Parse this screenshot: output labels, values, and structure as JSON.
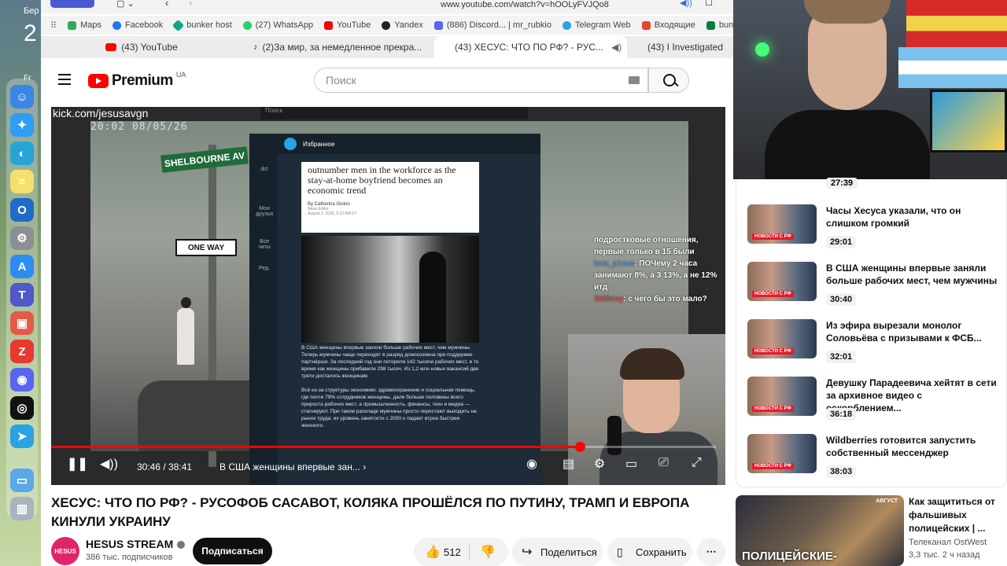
{
  "desktop": {
    "clock_a": "Бер",
    "clock_b": "2",
    "clock_c": "Fr"
  },
  "browser": {
    "url": "www.youtube.com/watch?v=hOOLyFVJQo8",
    "bookmarks": [
      "Maps",
      "Facebook",
      "bunker host",
      "(27) WhatsApp",
      "YouTube",
      "Yandex",
      "(886) Discord... | mr_rubkio",
      "Telegram Web",
      "Входящие",
      "bun"
    ],
    "tabs": [
      "(43) YouTube",
      "(2)За мир, за немедленное прекра...",
      "(43) ХЕСУС: ЧТО ПО РФ? - РУС...",
      "(43) I Investigated"
    ]
  },
  "header": {
    "logo": "Premium",
    "region": "UA",
    "search_placeholder": "Поиск"
  },
  "player": {
    "watermark": "kick.com/jesusavgn",
    "timestamp": "20:02  08/05/26",
    "street_sign": "SHELBOURNE AV",
    "oneway_sign": "ONE WAY",
    "tg_search": "Поиск",
    "tg_header": "Избранное",
    "tg_side": [
      "dct",
      "Мои друзья",
      "Все чаты",
      "Ред."
    ],
    "article_headline": "outnumber men in the workforce as the stay-at-home boyfriend becomes an economic trend",
    "article_by": "By Catherina Gioino",
    "article_role": "News Editor",
    "article_date": "August 2, 2026, 9:22 AM ET",
    "tg_message": "В США женщины впервые заняли больше рабочих мест, чем мужчины. Теперь мужчины чаще переходят в разряд домохозяина при поддержке партнёрши. За последний год они потеряли 142 тысячи рабочих мест, в то время как женщины прибавили 298 тысяч. Из 1,2 млн новых вакансий две трети досталось женщинам.\n\nВсё из-за структуры экономики: здравоохранение и социальная помощь, где почти 79% сотрудников женщины, дали больше половины всего прироста рабочих мест, а промышленность, финансы, техн и медиа — стагнируют. При таком раскладе мужчины просто перестают выходить на рынок труда: их уровень занятости с 2000-х падает втрое быстрее женского.",
    "chat_lines": [
      {
        "name": "",
        "text": "подростковые отношения, первые только в 15 были"
      },
      {
        "name": "lexa_p1sun",
        "text": ": ПОЧему 2 часа занимают 8%, а 3 13%, а не 12% итд"
      },
      {
        "name": "Skillmoy",
        "text": ": с чего бы это мало?"
      }
    ],
    "time_current": "30:46",
    "time_total": "38:41",
    "chapter": "В США женщины впервые зан...",
    "progress": 0.795
  },
  "video": {
    "title": "ХЕСУС: ЧТО ПО РФ? - РУСОФОБ САСАВОТ, КОЛЯКА ПРОШЁЛСЯ ПО ПУТИНУ, ТРАМП И ЕВРОПА КИНУЛИ УКРАИНУ",
    "channel": "HESUS STREAM",
    "channel_avatar": "HESUS",
    "subscribers": "386 тыс. подписчиков",
    "subscribe": "Подписаться",
    "likes": "512",
    "share": "Поделиться",
    "save": "Сохранить"
  },
  "sidebar": {
    "top_duration": "27:39",
    "thumb_label": "НОВОСТИ С РФ",
    "items": [
      {
        "title": "Часы Хесуса указали, что он слишком громкий",
        "duration": "29:01"
      },
      {
        "title": "В США женщины впервые заняли больше рабочих мест, чем мужчины",
        "duration": "30:40"
      },
      {
        "title": "Из эфира вырезали монолог Соловьёва с призывами к ФСБ...",
        "duration": "32:01"
      },
      {
        "title": "Девушку Парадеевича хейтят в сети за архивное видео с оскорблением...",
        "duration": "36:18"
      },
      {
        "title": "Wildberries готовится запустить собственный мессенджер",
        "duration": "38:03"
      }
    ],
    "recommended": {
      "title": "Как защититься от фальшивых полицейских | ...",
      "channel": "Телеканал OstWest",
      "meta": "3,3 тыс.  2 ч назад",
      "thumb_text": "ПОЛИЦЕЙСКИЕ-",
      "thumb_badge": "АВГУСТ"
    }
  }
}
